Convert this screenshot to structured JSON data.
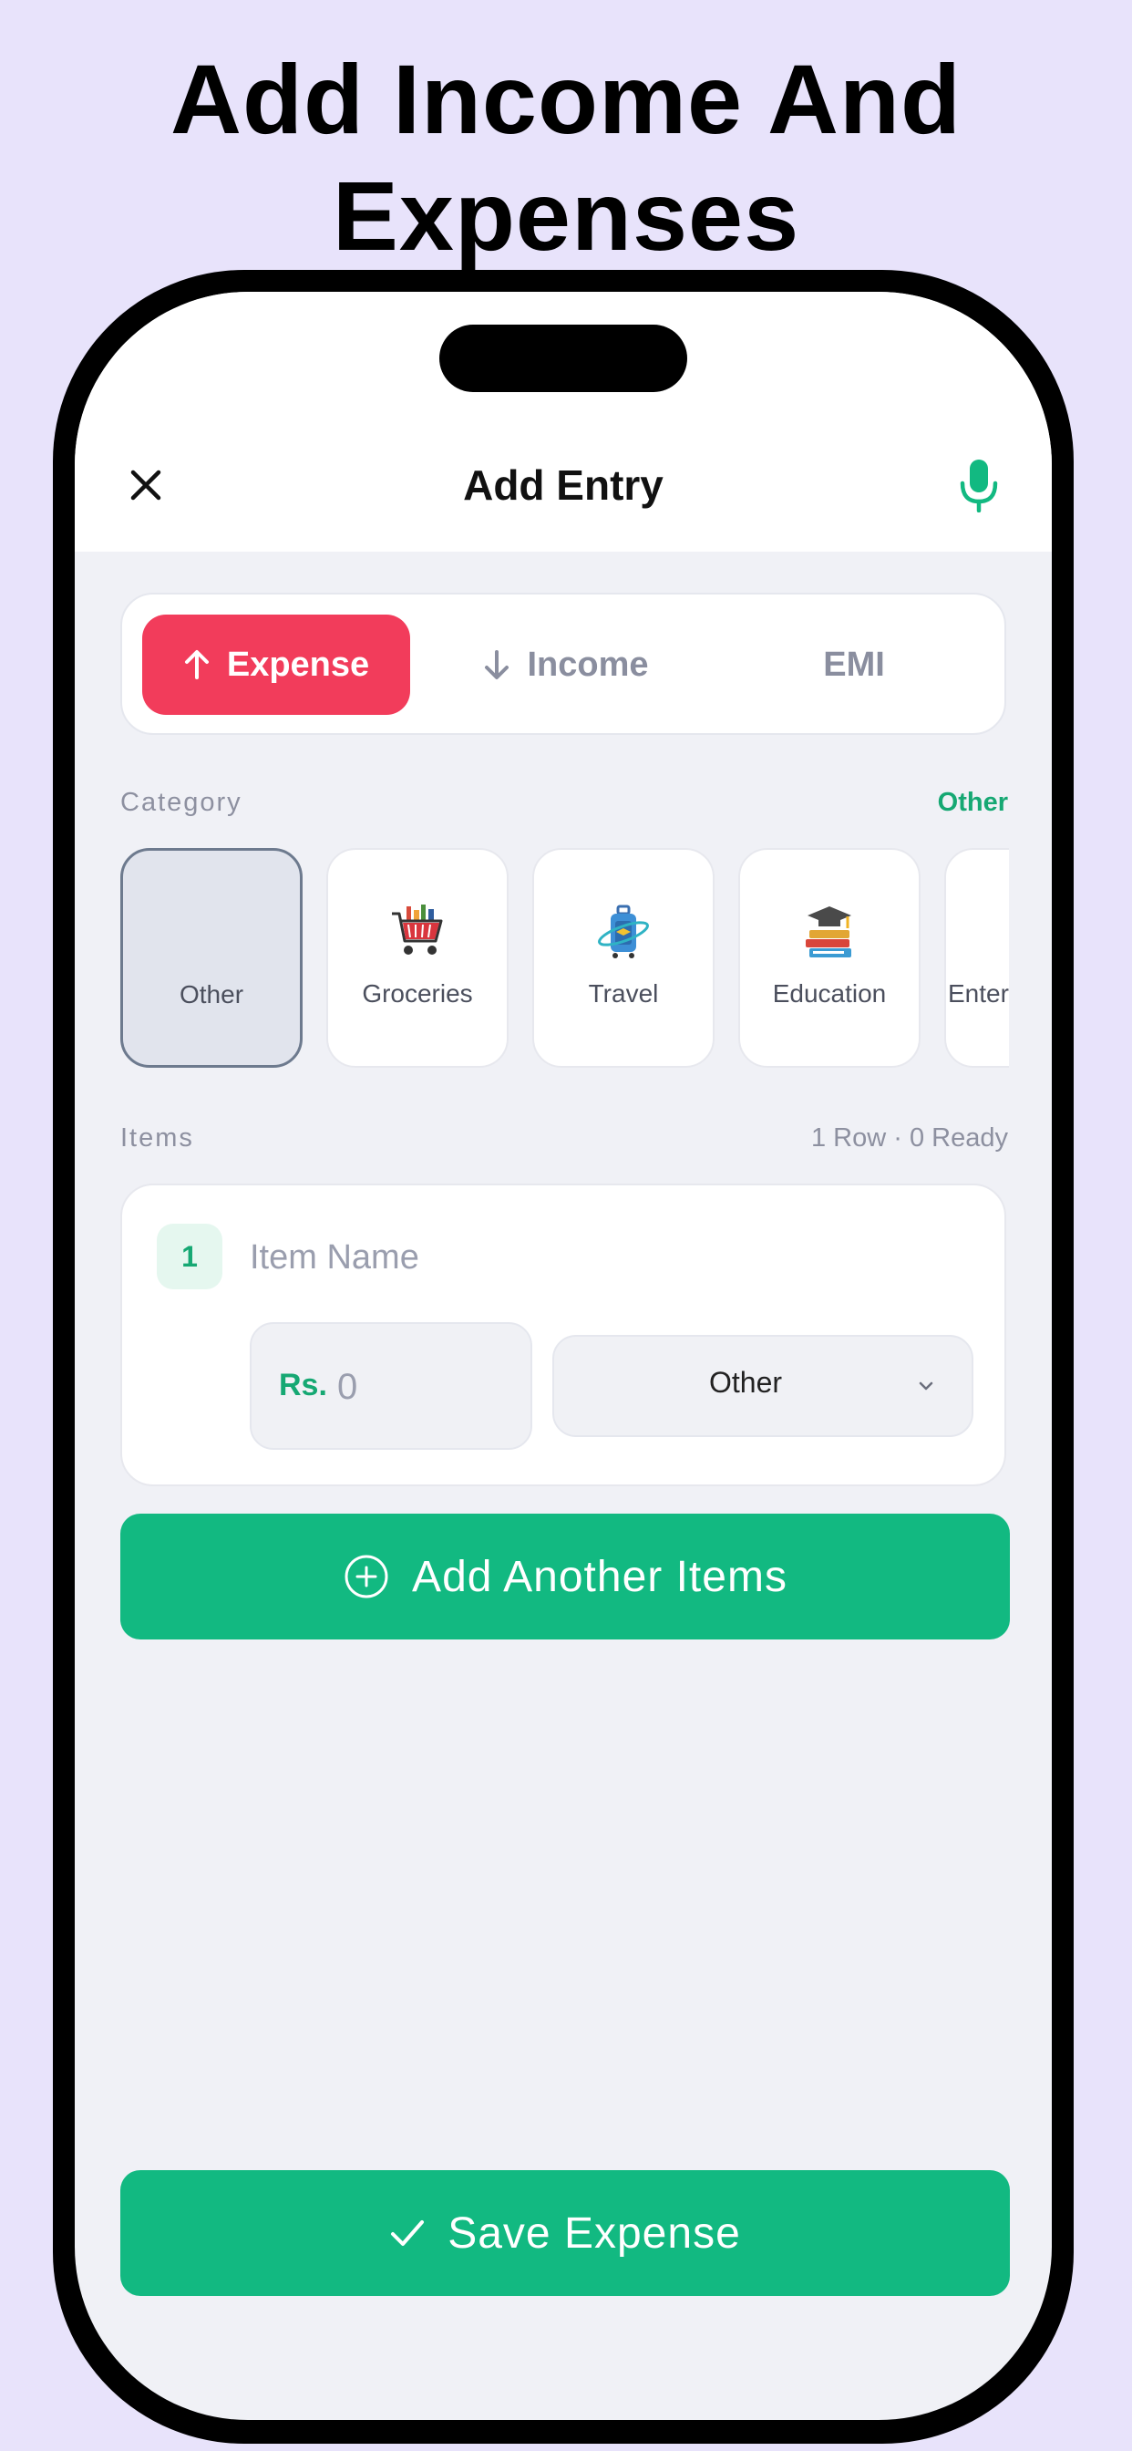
{
  "headline": {
    "line1": "Add Income And",
    "line2": "Expenses"
  },
  "appbar": {
    "title": "Add Entry",
    "close_icon": "close-icon",
    "mic_icon": "microphone-icon"
  },
  "type_selector": {
    "options": [
      {
        "label": "Expense",
        "icon": "arrow-up-icon",
        "active": true
      },
      {
        "label": "Income",
        "icon": "arrow-down-icon",
        "active": false
      },
      {
        "label": "EMI",
        "icon": "",
        "active": false
      }
    ]
  },
  "category": {
    "label": "Category",
    "selected_value": "Other",
    "items": [
      {
        "label": "Other",
        "icon": "",
        "selected": true
      },
      {
        "label": "Groceries",
        "icon": "shopping-cart-icon",
        "selected": false
      },
      {
        "label": "Travel",
        "icon": "suitcase-icon",
        "selected": false
      },
      {
        "label": "Education",
        "icon": "books-graduation-cap-icon",
        "selected": false
      },
      {
        "label": "Enter",
        "icon": "",
        "selected": false
      }
    ]
  },
  "items_section": {
    "label": "Items",
    "status": "1 Row · 0 Ready",
    "rows": [
      {
        "number": "1",
        "name_placeholder": "Item Name",
        "currency_prefix": "Rs.",
        "amount_placeholder": "0",
        "category_value": "Other"
      }
    ]
  },
  "add_button": {
    "label": "Add Another Items",
    "icon": "plus-circle-icon"
  },
  "save_button": {
    "label": "Save Expense",
    "icon": "checkmark-icon"
  },
  "colors": {
    "background": "#e8e3fb",
    "expense_active": "#f23c5b",
    "primary_green": "#12b981",
    "accent_green_text": "#16a873"
  }
}
